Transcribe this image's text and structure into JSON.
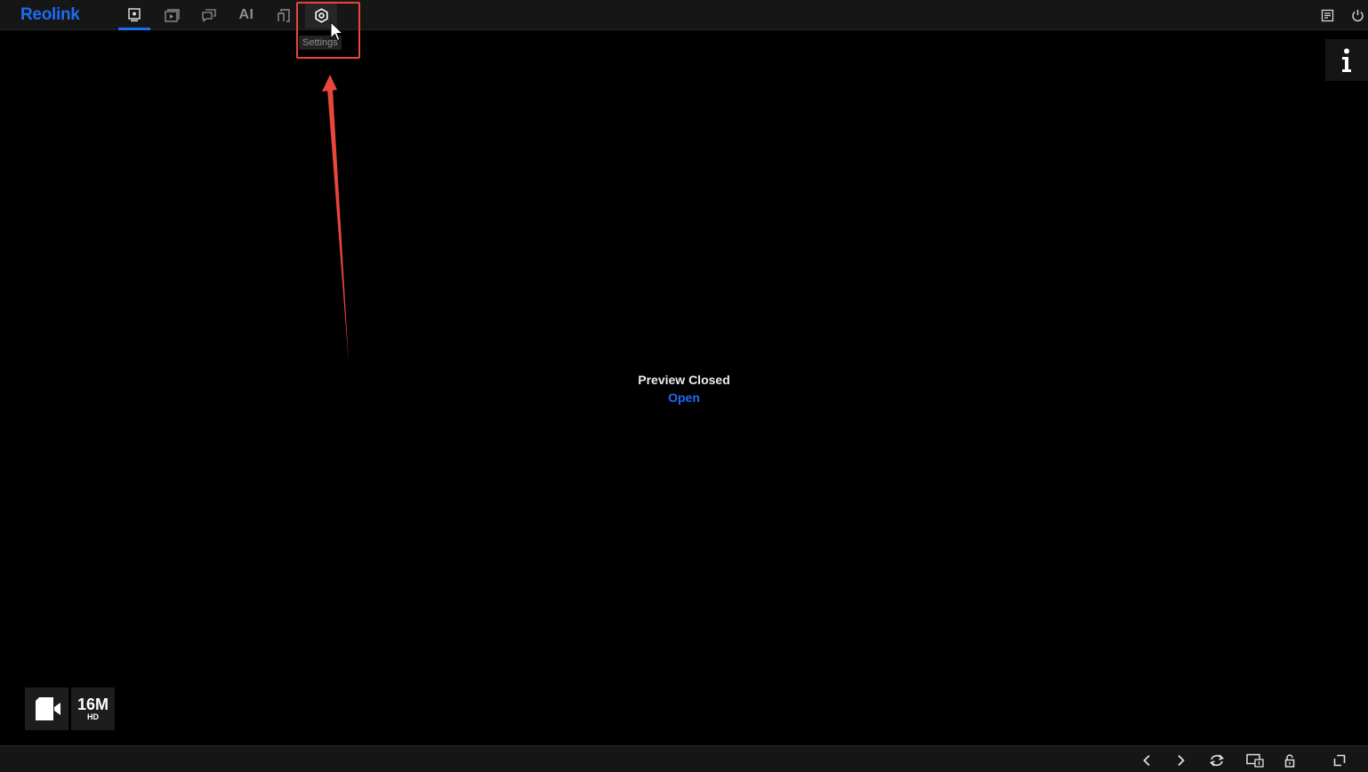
{
  "brand": {
    "logo": "Reolink",
    "accent": "#1e6cf2"
  },
  "nav": {
    "items": [
      {
        "name": "live-view",
        "icon": "camera-icon",
        "active": true
      },
      {
        "name": "playback",
        "icon": "playback-icon"
      },
      {
        "name": "messages",
        "icon": "messages-icon"
      },
      {
        "name": "ai",
        "label": "AI"
      },
      {
        "name": "channel-manage",
        "icon": "channel-icon"
      },
      {
        "name": "settings",
        "icon": "settings-gear-icon",
        "hovered": true
      }
    ],
    "tooltip": "Settings"
  },
  "top_right": [
    {
      "name": "notes",
      "icon": "notes-icon"
    },
    {
      "name": "power",
      "icon": "power-icon"
    }
  ],
  "info_button": {
    "icon": "info-icon",
    "label": "i"
  },
  "preview": {
    "title": "Preview Closed",
    "open_link": "Open"
  },
  "status_badges": {
    "camera_icon": "video-camera-icon",
    "resolution": "16M",
    "quality": "HD"
  },
  "bottom_toolbar": [
    {
      "name": "prev",
      "icon": "chevron-left-icon"
    },
    {
      "name": "next",
      "icon": "chevron-right-icon"
    },
    {
      "name": "refresh",
      "icon": "refresh-icon"
    },
    {
      "name": "layout",
      "icon": "screen-layout-icon"
    },
    {
      "name": "lock",
      "icon": "unlock-icon"
    },
    {
      "name": "fullscreen",
      "icon": "fullscreen-icon"
    }
  ],
  "annotation": {
    "highlight_color": "#e7473a"
  }
}
